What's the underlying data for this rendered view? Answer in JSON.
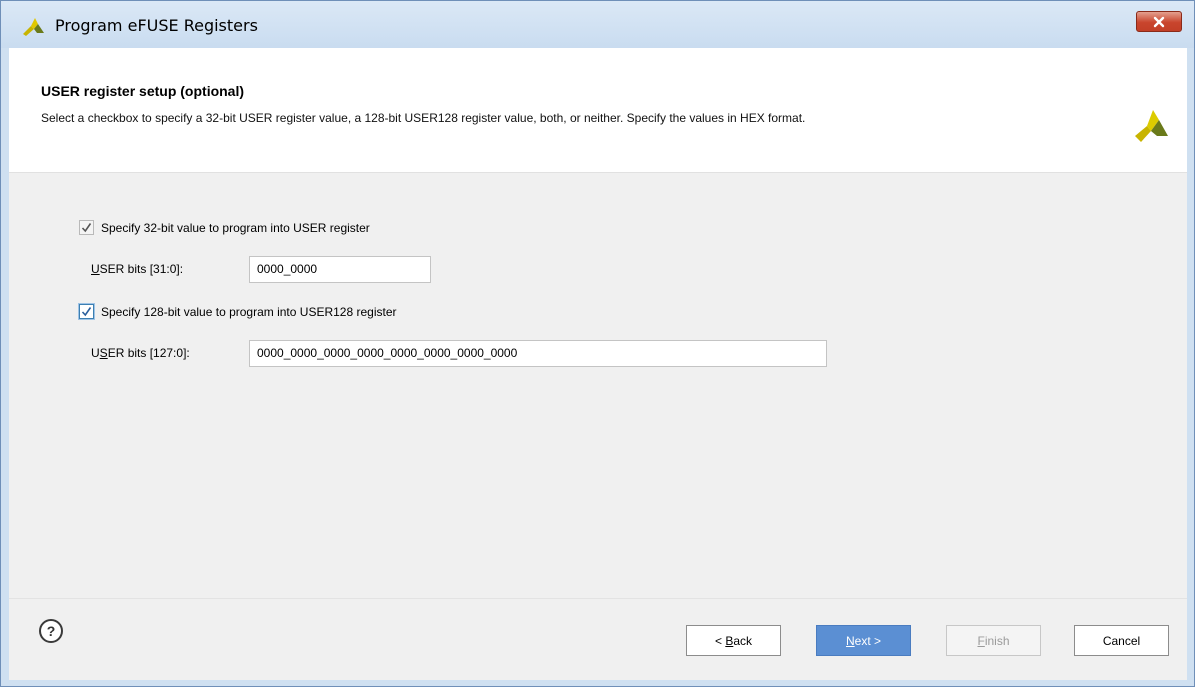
{
  "window": {
    "title": "Program eFUSE Registers",
    "close_icon": "close-icon"
  },
  "header": {
    "title": "USER register setup (optional)",
    "description": "Select a checkbox to specify a 32-bit USER register value, a 128-bit USER128 register value, both, or neither. Specify the values in HEX format.",
    "logo_icon": "xilinx-logo-icon"
  },
  "options": {
    "user32": {
      "checkbox_label": "Specify 32-bit value to program into USER register",
      "checked": true,
      "field_label_u": "U",
      "field_label_rest": "SER bits [31:0]:",
      "value": "0000_0000"
    },
    "user128": {
      "checkbox_label": "Specify 128-bit value to program into USER128 register",
      "checked": true,
      "field_label_pre": "U",
      "field_label_u": "S",
      "field_label_rest": "ER bits [127:0]:",
      "value": "0000_0000_0000_0000_0000_0000_0000_0000"
    }
  },
  "footer": {
    "help_label": "?",
    "back_prefix": "< ",
    "back_u": "B",
    "back_rest": "ack",
    "next_u": "N",
    "next_rest": "ext >",
    "finish_u": "F",
    "finish_rest": "inish",
    "cancel": "Cancel"
  },
  "colors": {
    "primary_button": "#5b8fd3",
    "close_button": "#c9452d",
    "title_bar": "#cfe0f1",
    "logo_yellow": "#c8b400",
    "logo_green": "#6a7a1a"
  }
}
